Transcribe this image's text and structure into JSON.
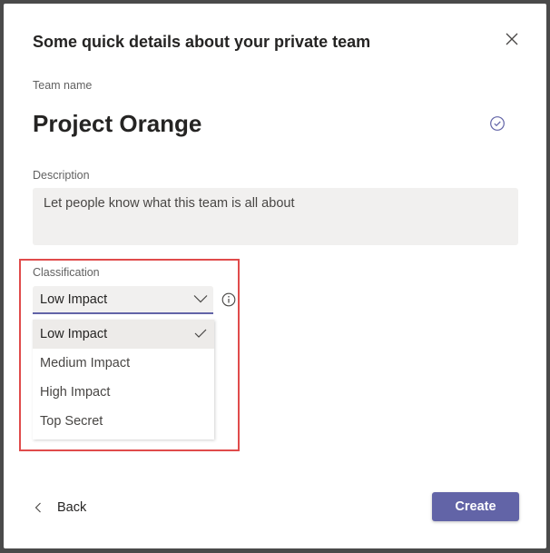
{
  "dialog": {
    "title": "Some quick details about your private team",
    "close_icon": "close-icon"
  },
  "team_name": {
    "label": "Team name",
    "value": "Project Orange",
    "status_icon": "check-circle-icon"
  },
  "description": {
    "label": "Description",
    "placeholder": "Let people know what this team is all about"
  },
  "classification": {
    "label": "Classification",
    "selected": "Low Impact",
    "info_icon": "info-icon",
    "options": [
      {
        "label": "Low Impact",
        "selected": true
      },
      {
        "label": "Medium Impact",
        "selected": false
      },
      {
        "label": "High Impact",
        "selected": false
      },
      {
        "label": "Top Secret",
        "selected": false
      }
    ]
  },
  "footer": {
    "back_label": "Back",
    "create_label": "Create"
  },
  "colors": {
    "accent": "#6264a7",
    "highlight": "#e04b4b"
  }
}
